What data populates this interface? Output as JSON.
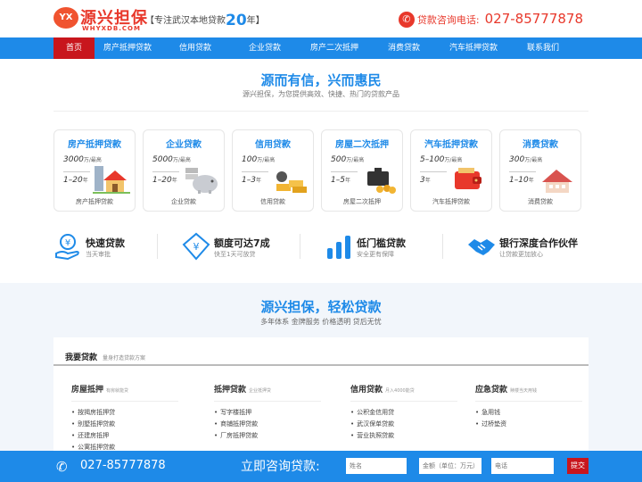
{
  "header": {
    "logo_badge": "YX",
    "logo_name": "源兴担保",
    "logo_en": "WHYXDB.COM",
    "slogan_left": "【专注武汉本地贷款",
    "slogan_num": "20",
    "slogan_right": "年】",
    "hotline_label": "贷款咨询电话:",
    "hotline_number": "027-85777878"
  },
  "nav": [
    "首页",
    "房产抵押贷款",
    "信用贷款",
    "企业贷款",
    "房产二次抵押",
    "消费贷款",
    "汽车抵押贷款",
    "联系我们"
  ],
  "section1": {
    "title": "源而有信，兴而惠民",
    "subtitle": "源兴担保，为您提供高效、快捷、热门的贷款产品"
  },
  "cards": [
    {
      "title": "房产抵押贷款",
      "amount": "3000",
      "amount_unit": "万/最高",
      "term": "1–20",
      "term_unit": "年",
      "label": "房产抵押贷款"
    },
    {
      "title": "企业贷款",
      "amount": "5000",
      "amount_unit": "万/最高",
      "term": "1–20",
      "term_unit": "年",
      "label": "企业贷款"
    },
    {
      "title": "信用贷款",
      "amount": "100",
      "amount_unit": "万/最高",
      "term": "1–3",
      "term_unit": "年",
      "label": "信用贷款"
    },
    {
      "title": "房屋二次抵押",
      "amount": "500",
      "amount_unit": "万/最高",
      "term": "1–5",
      "term_unit": "年",
      "label": "房屋二次抵押"
    },
    {
      "title": "汽车抵押贷款",
      "amount": "5–100",
      "amount_unit": "万/最高",
      "term": "3",
      "term_unit": "年",
      "label": "汽车抵押贷款"
    },
    {
      "title": "消费贷款",
      "amount": "300",
      "amount_unit": "万/最高",
      "term": "1–10",
      "term_unit": "年",
      "label": "消费贷款"
    }
  ],
  "features": [
    {
      "title": "快速贷款",
      "sub": "当天审批",
      "icon": "hand-yen-icon"
    },
    {
      "title": "额度可达7成",
      "sub": "快至1天可放贷",
      "icon": "yen-tag-icon"
    },
    {
      "title": "低门槛贷款",
      "sub": "安全更有保障",
      "icon": "bars-icon"
    },
    {
      "title": "银行深度合作伙伴",
      "sub": "让贷款更加放心",
      "icon": "handshake-icon"
    }
  ],
  "section2": {
    "title": "源兴担保，轻松贷款",
    "subtitle": "多年体系 金牌服务 价格透明 贷后无忧"
  },
  "panel": {
    "title": "我要贷款",
    "subtitle": "量身打造贷款方案"
  },
  "columns": [
    {
      "title": "房屋抵押",
      "sub": "有房就能贷",
      "items": [
        "按揭房抵押贷",
        "别墅抵押贷款",
        "还建房抵押",
        "公寓抵押贷款"
      ]
    },
    {
      "title": "抵押贷款",
      "sub": "企业抵押贷",
      "items": [
        "写字楼抵押",
        "商铺抵押贷款",
        "厂房抵押贷款"
      ]
    },
    {
      "title": "信用贷款",
      "sub": "月入4000能贷",
      "items": [
        "公积金信用贷",
        "武汉保单贷款",
        "营业执照贷款"
      ]
    },
    {
      "title": "应急贷款",
      "sub": "赎楼当天用钱",
      "items": [
        "急用钱",
        "过桥垫资"
      ]
    }
  ],
  "footer": {
    "phone": "027-85777878",
    "cta": "立即咨询贷款:",
    "name_placeholder": "姓名",
    "amount_placeholder": "金额（单位：万元）",
    "phone_placeholder": "电话",
    "submit": "提交"
  },
  "colors": {
    "brand_blue": "#1e8ae8",
    "brand_red": "#c8161d",
    "logo_red": "#e8382b"
  }
}
